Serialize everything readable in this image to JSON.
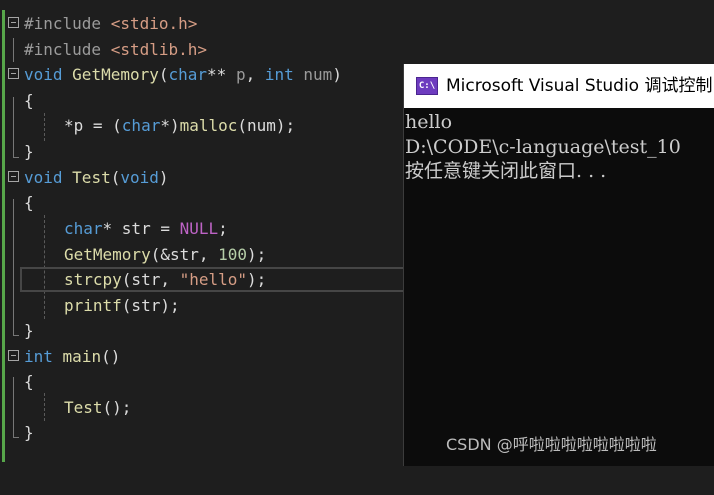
{
  "editor": {
    "lines": [
      {
        "pp": "#include ",
        "inc": "<stdio.h>"
      },
      {
        "pp": "#include ",
        "inc": "<stdlib.h>"
      },
      {
        "kw": "void",
        "fn": "GetMemory",
        "open": "(",
        "kw2": "char",
        "stars": "** ",
        "p1": "p",
        "comma": ", ",
        "kw3": "int",
        "sp": " ",
        "p2": "num",
        "close": ")"
      },
      {
        "brace": "{"
      },
      {
        "text_a": "*p = (",
        "kw": "char",
        "text_b": "*)",
        "fn": "malloc",
        "text_c": "(num);"
      },
      {
        "brace": "}"
      },
      {
        "kw": "void",
        "fn": "Test",
        "open": "(",
        "kw2": "void",
        "close": ")"
      },
      {
        "brace": "{"
      },
      {
        "kw": "char",
        "text_a": "* str = ",
        "macro": "NULL",
        "text_b": ";"
      },
      {
        "fn": "GetMemory",
        "text_a": "(&str, ",
        "num": "100",
        "text_b": ");"
      },
      {
        "fn": "strcpy",
        "text_a": "(str, ",
        "str": "\"hello\"",
        "text_b": ");"
      },
      {
        "fn": "printf",
        "text_a": "(str);"
      },
      {
        "brace": "}"
      },
      {
        "kw": "int",
        "fn": "main",
        "text_a": "()"
      },
      {
        "brace": "{"
      },
      {
        "fn": "Test",
        "text_a": "();"
      },
      {
        "brace": "}"
      }
    ]
  },
  "console": {
    "icon_text": "C:\\",
    "title": "Microsoft Visual Studio 调试控制",
    "output": [
      "hello",
      "D:\\CODE\\c-language\\test_10",
      "按任意键关闭此窗口. . ."
    ]
  },
  "watermark": "CSDN @呼啦啦啦啦啦啦啦啦",
  "colors": {
    "keyword": "#569cd6",
    "function": "#dcdcaa",
    "string": "#d69d85",
    "macro": "#bd63c5",
    "number": "#b5cea8",
    "change_bar": "#57a64a",
    "editor_bg": "#1e1e1e",
    "console_bg": "#0c0c0c"
  }
}
